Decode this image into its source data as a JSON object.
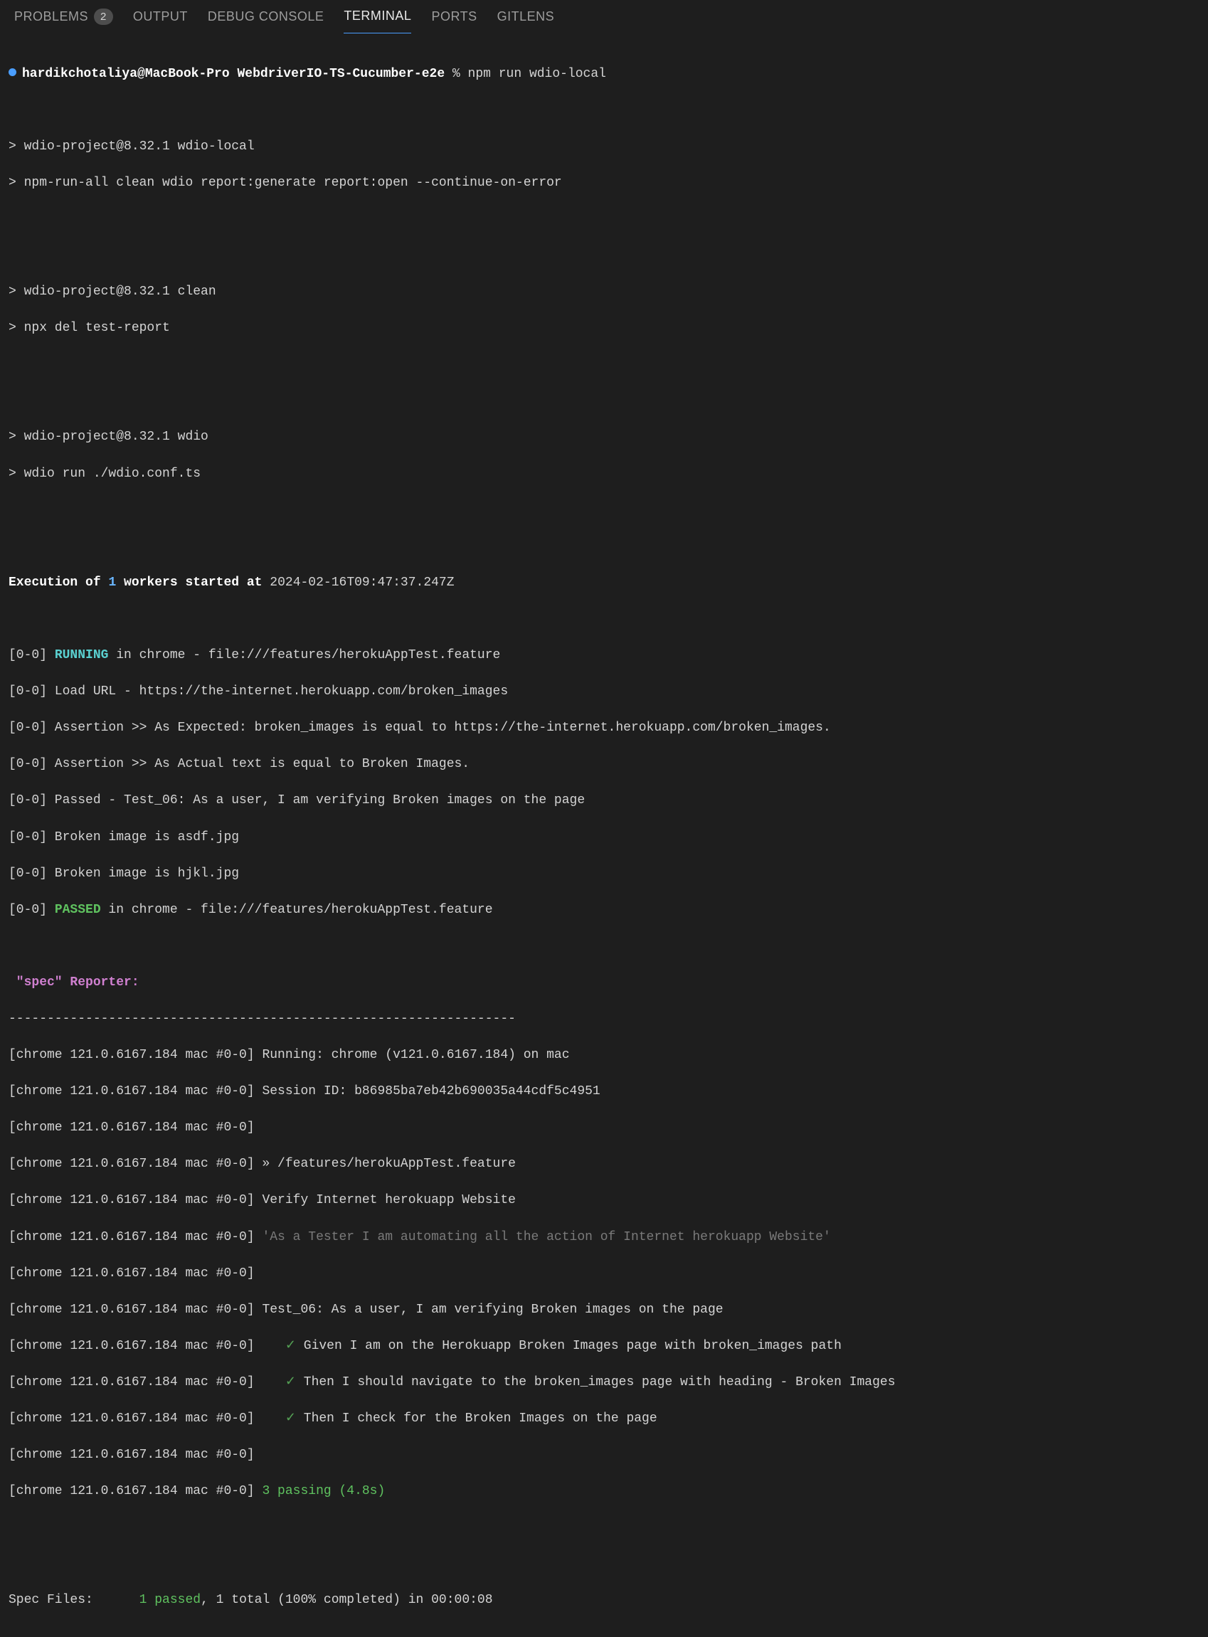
{
  "tabs": {
    "problems": "PROBLEMS",
    "problemsBadge": "2",
    "output": "OUTPUT",
    "debugConsole": "DEBUG CONSOLE",
    "terminal": "TERMINAL",
    "ports": "PORTS",
    "gitlens": "GITLENS"
  },
  "prompt": {
    "user": "hardikchotaliya@MacBook-Pro",
    "dir": "WebdriverIO-TS-Cucumber-e2e",
    "sep": " % ",
    "cmd": "npm run wdio-local"
  },
  "block1": {
    "l1": "> wdio-project@8.32.1 wdio-local",
    "l2": "> npm-run-all clean wdio report:generate report:open --continue-on-error"
  },
  "block2": {
    "l1": "> wdio-project@8.32.1 clean",
    "l2": "> npx del test-report"
  },
  "block3": {
    "l1": "> wdio-project@8.32.1 wdio",
    "l2": "> wdio run ./wdio.conf.ts"
  },
  "exec": {
    "prefix": "Execution of ",
    "count": "1",
    "mid": " workers started at ",
    "ts": "2024-02-16T09:47:37.247Z"
  },
  "run": {
    "l1_prefix": "[0-0] ",
    "l1_status": "RUNNING",
    "l1_rest": " in chrome - file:///features/herokuAppTest.feature",
    "l2": "[0-0] Load URL - https://the-internet.herokuapp.com/broken_images",
    "l3": "[0-0] Assertion >> As Expected: broken_images is equal to https://the-internet.herokuapp.com/broken_images.",
    "l4": "[0-0] Assertion >> As Actual text is equal to Broken Images.",
    "l5": "[0-0] Passed - Test_06: As a user, I am verifying Broken images on the page",
    "l6": "[0-0] Broken image is asdf.jpg",
    "l7": "[0-0] Broken image is hjkl.jpg",
    "l8_prefix": "[0-0] ",
    "l8_status": "PASSED",
    "l8_rest": " in chrome - file:///features/herokuAppTest.feature"
  },
  "spec": {
    "quote1": " \"spec\"",
    "label": " Reporter:",
    "divider": "------------------------------------------------------------------",
    "tag": "[chrome 121.0.6167.184 mac #0-0]",
    "r1": " Running: chrome (v121.0.6167.184) on mac",
    "r2": " Session ID: b86985ba7eb42b690035a44cdf5c4951",
    "r3": "",
    "r4": " » /features/herokuAppTest.feature",
    "r5": " Verify Internet herokuapp Website",
    "r6": " 'As a Tester I am automating all the action of Internet herokuapp Website'",
    "r7": "",
    "r8": " Test_06: As a user, I am verifying Broken images on the page",
    "check": "✓",
    "r9": " Given I am on the Herokuapp Broken Images page with broken_images path",
    "r10": " Then I should navigate to the broken_images page with heading - Broken Images",
    "r11": " Then I check for the Broken Images on the page",
    "r12": "",
    "passing": " 3 passing (4.8s)"
  },
  "summary": {
    "label": "Spec Files:      ",
    "passed": "1 passed",
    "rest": ", 1 total (100% completed) in 00:00:08"
  }
}
